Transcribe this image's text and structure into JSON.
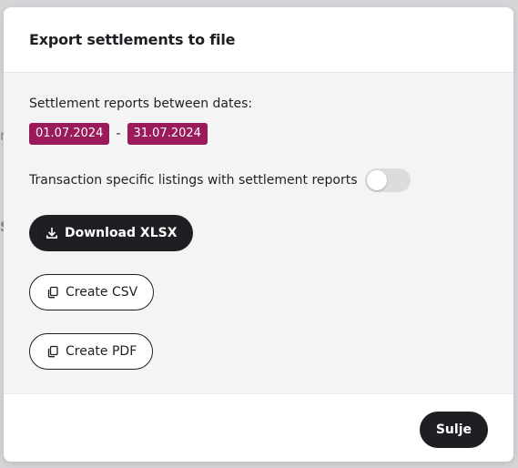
{
  "modal": {
    "title": "Export settlements to file",
    "range_label": "Settlement reports between dates:",
    "date_from": "01.07.2024",
    "date_separator": "-",
    "date_to": "31.07.2024",
    "toggle_label": "Transaction specific listings with settlement reports",
    "toggle_on": false,
    "buttons": {
      "download_xlsx": "Download XLSX",
      "create_csv": "Create CSV",
      "create_pdf": "Create PDF"
    },
    "close_label": "Sulje"
  },
  "colors": {
    "accent": "#9b1b5a",
    "dark": "#1f1f23"
  },
  "icons": {
    "download": "download-icon",
    "copy": "copy-icon"
  }
}
